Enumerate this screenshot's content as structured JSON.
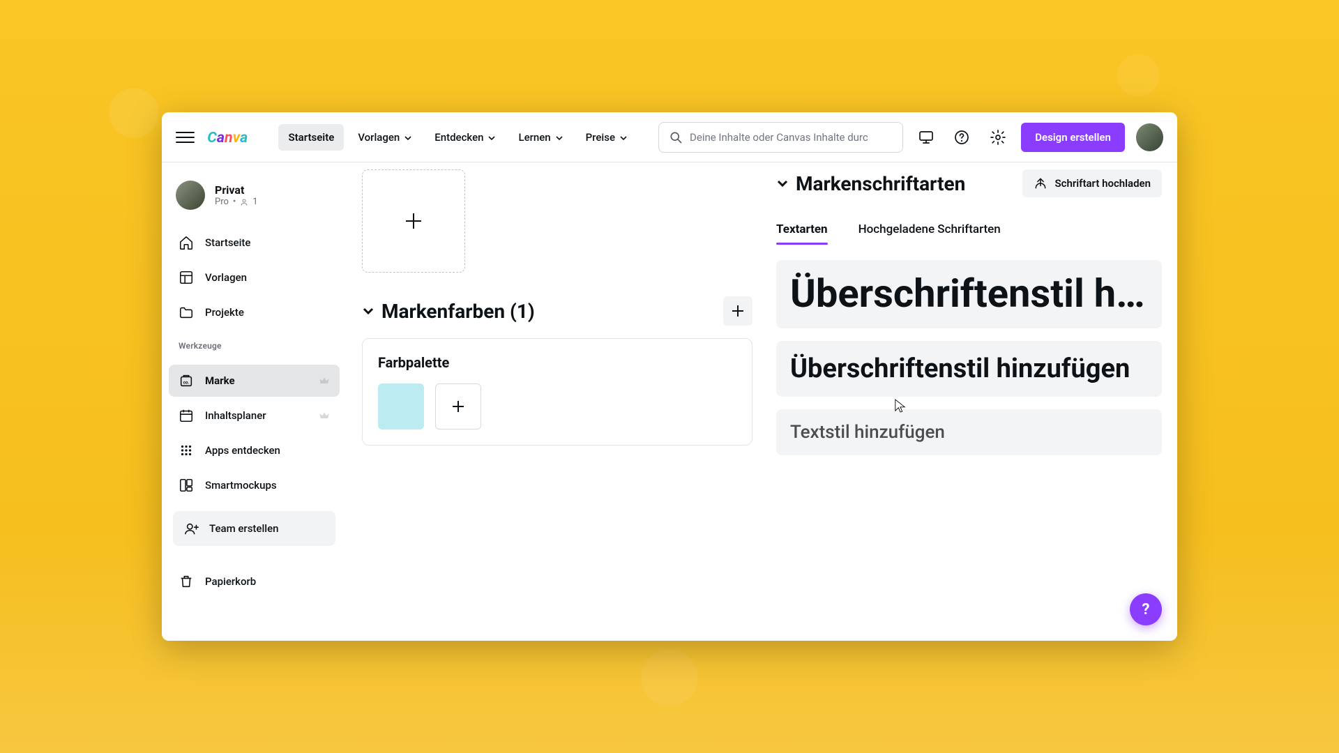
{
  "header": {
    "nav": {
      "home": "Startseite",
      "templates": "Vorlagen",
      "discover": "Entdecken",
      "learn": "Lernen",
      "pricing": "Preise"
    },
    "search_placeholder": "Deine Inhalte oder Canvas Inhalte durc",
    "cta": "Design erstellen"
  },
  "sidebar": {
    "team_name": "Privat",
    "team_plan": "Pro",
    "team_count": "1",
    "items": {
      "home": "Startseite",
      "templates": "Vorlagen",
      "projects": "Projekte"
    },
    "tools_heading": "Werkzeuge",
    "tools": {
      "brand": "Marke",
      "planner": "Inhaltsplaner",
      "apps": "Apps entdecken",
      "smartmockups": "Smartmockups"
    },
    "team_create": "Team erstellen",
    "trash": "Papierkorb"
  },
  "brand_colors": {
    "heading": "Markenfarben (1)",
    "palette_title": "Farbpalette",
    "colors": [
      "#bdebf2"
    ]
  },
  "brand_fonts": {
    "heading": "Markenschriftarten",
    "upload": "Schriftart hochladen",
    "tabs": {
      "text": "Textarten",
      "uploaded": "Hochgeladene Schriftarten"
    },
    "h1": "Überschriftenstil hi…",
    "h2": "Überschriftenstil hinzufügen",
    "body": "Textstil hinzufügen"
  },
  "fab": "?"
}
